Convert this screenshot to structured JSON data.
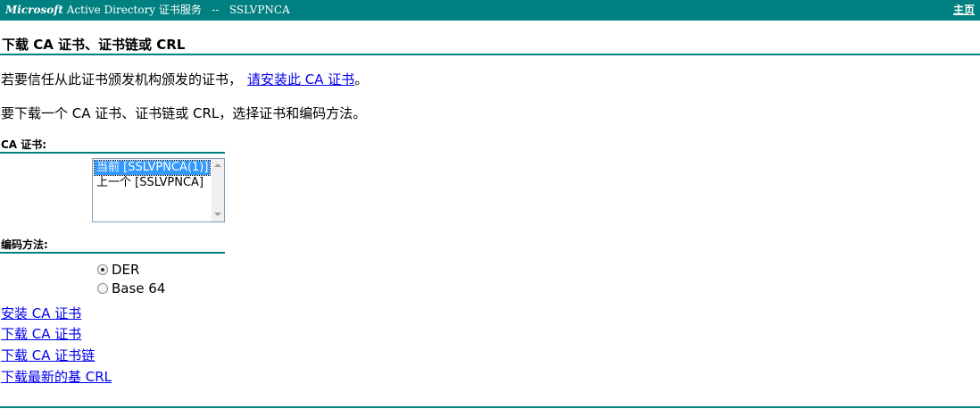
{
  "header": {
    "brand_ms": "Microsoft",
    "brand_rest": " Active Directory 证书服务   --   SSLVPNCA",
    "home_link": "主页",
    "bar_color": "#008080"
  },
  "page": {
    "title": "下载 CA 证书、证书链或 CRL",
    "intro_prefix": "若要信任从此证书颁发机构颁发的证书，",
    "intro_link": "请安装此 CA 证书",
    "intro_suffix": "。",
    "instruction": "要下载一个 CA 证书、证书链或 CRL，选择证书和编码方法。"
  },
  "ca_cert": {
    "label": "CA 证书:",
    "options": [
      "当前 [SSLVPNCA(1)]",
      "上一个 [SSLVPNCA]"
    ],
    "selected": "当前 [SSLVPNCA(1)]"
  },
  "encoding": {
    "label": "编码方法:",
    "options": [
      "DER",
      "Base 64"
    ],
    "selected": "DER"
  },
  "links": {
    "install_ca": "安装 CA 证书",
    "download_ca": "下载 CA 证书",
    "download_chain": "下载 CA 证书链",
    "download_crl": "下载最新的基 CRL"
  }
}
